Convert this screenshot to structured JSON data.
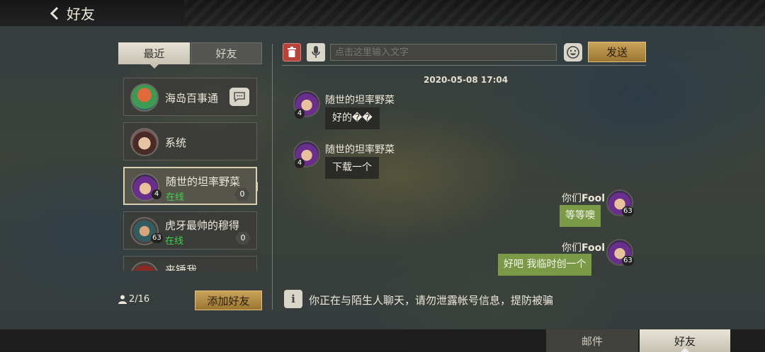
{
  "header": {
    "back_icon": "chevron-left-icon",
    "title": "好友"
  },
  "sidebar": {
    "tabs": [
      {
        "label": "最近",
        "active": true
      },
      {
        "label": "好友",
        "active": false
      }
    ],
    "friends": [
      {
        "name": "海岛百事通",
        "avatar": "parrot",
        "status": "",
        "level": "",
        "unread": "",
        "action_icon": "chat-bubble-icon"
      },
      {
        "name": "系统",
        "avatar": "girl",
        "status": "",
        "level": "",
        "unread": ""
      },
      {
        "name": "随世的坦率野菜",
        "avatar": "purple",
        "status": "在线",
        "level": "4",
        "unread": "0",
        "selected": true
      },
      {
        "name": "虎牙最帅的穆得",
        "avatar": "warrior",
        "status": "在线",
        "level": "63",
        "unread": "0"
      },
      {
        "name": "来锤我",
        "avatar": "red",
        "status": "",
        "level": "",
        "unread": ""
      }
    ],
    "friend_count": "2/16",
    "add_friend_label": "添加好友"
  },
  "chat": {
    "input_placeholder": "点击这里输入文字",
    "send_label": "发送",
    "timestamp": "2020-05-08  17:04",
    "messages": [
      {
        "from": "随世的坦率野菜",
        "level": "4",
        "text": "好的��",
        "direction": "in"
      },
      {
        "from": "随世的坦率野菜",
        "level": "4",
        "text": "下载一个",
        "direction": "in"
      },
      {
        "from_prefix": "你们",
        "from_bold": "Fool",
        "level": "63",
        "text": "等等噢",
        "direction": "out"
      },
      {
        "from_prefix": "你们",
        "from_bold": "Fool",
        "level": "63",
        "text": "好吧 我临时创一个",
        "direction": "out"
      }
    ],
    "notice": "你正在与陌生人聊天，请勿泄露帐号信息，提防被骗"
  },
  "bottom_tabs": [
    {
      "label": "邮件",
      "active": false
    },
    {
      "label": "好友",
      "active": true
    }
  ],
  "colors": {
    "accent_gold": "#caa35a",
    "online_green": "#3fcf4a",
    "outgoing_bubble": "#7a9a48",
    "delete_red": "#b8433a"
  }
}
